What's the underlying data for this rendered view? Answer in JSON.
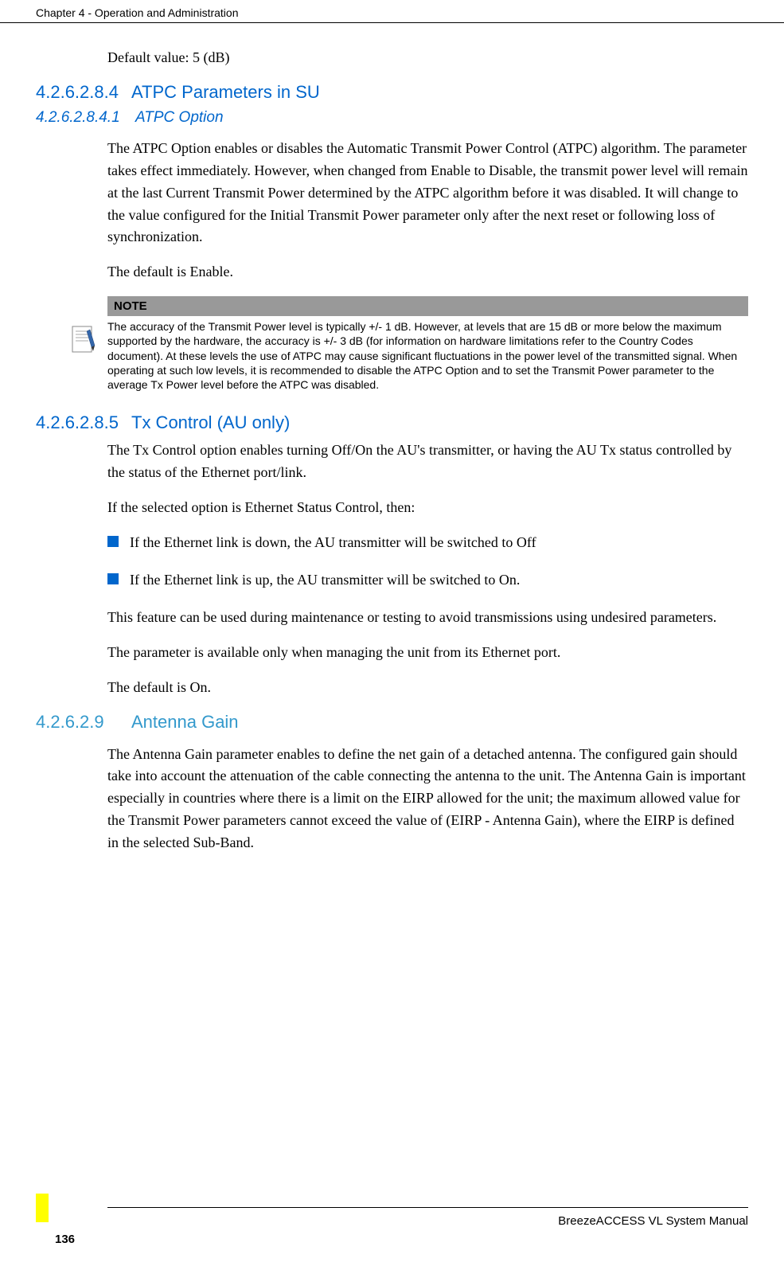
{
  "header": {
    "chapter": "Chapter 4 - Operation and Administration"
  },
  "sections": {
    "defaultValue": "Default value: 5 (dB)",
    "s1": {
      "num": "4.2.6.2.8.4",
      "title": "ATPC Parameters in SU"
    },
    "s2": {
      "num": "4.2.6.2.8.4.1",
      "title": "ATPC Option"
    },
    "s2_para1": "The ATPC Option enables or disables the Automatic Transmit Power Control (ATPC) algorithm. The parameter takes effect immediately. However, when changed from Enable to Disable, the transmit power level will remain at the last Current Transmit Power determined by the ATPC algorithm before it was disabled. It will change to the value configured for the Initial Transmit Power parameter only after the next reset or following loss of synchronization.",
    "s2_para2": "The default is Enable.",
    "note": {
      "header": "NOTE",
      "text": "The accuracy of the Transmit Power level is typically +/- 1 dB. However, at levels that are 15 dB or more below the maximum supported by the hardware, the accuracy is +/- 3 dB (for information on hardware limitations refer to the Country Codes document). At these levels the use of ATPC may cause significant fluctuations in the power level of the transmitted signal. When operating at such low levels, it is recommended to disable the ATPC Option and to set the Transmit Power parameter to the average Tx Power level before the ATPC was disabled."
    },
    "s3": {
      "num": "4.2.6.2.8.5",
      "title": "Tx Control (AU only)"
    },
    "s3_para1": "The Tx Control option enables turning Off/On the AU's transmitter, or having the AU Tx status controlled by the status of the Ethernet port/link.",
    "s3_para2": "If the selected option is Ethernet Status Control, then:",
    "s3_bullet1": "If the Ethernet link is down, the AU transmitter will be switched to Off",
    "s3_bullet2": "If the Ethernet link is up, the AU transmitter will be switched to On.",
    "s3_para3": "This feature can be used during maintenance or testing to avoid transmissions using undesired parameters.",
    "s3_para4": "The parameter is available only when managing the unit from its Ethernet port.",
    "s3_para5": "The default is On.",
    "s4": {
      "num": "4.2.6.2.9",
      "title": "Antenna Gain"
    },
    "s4_para1": "The Antenna Gain parameter enables to define the net gain of a detached antenna. The configured gain should take into account the attenuation of the cable connecting the antenna to the unit. The Antenna Gain is important especially in countries where there is a limit on the EIRP allowed for the unit; the maximum allowed value for the Transmit Power parameters cannot exceed the value of (EIRP - Antenna Gain), where the EIRP is defined in the selected Sub-Band."
  },
  "footer": {
    "manual": "BreezeACCESS VL System Manual",
    "page": "136"
  }
}
